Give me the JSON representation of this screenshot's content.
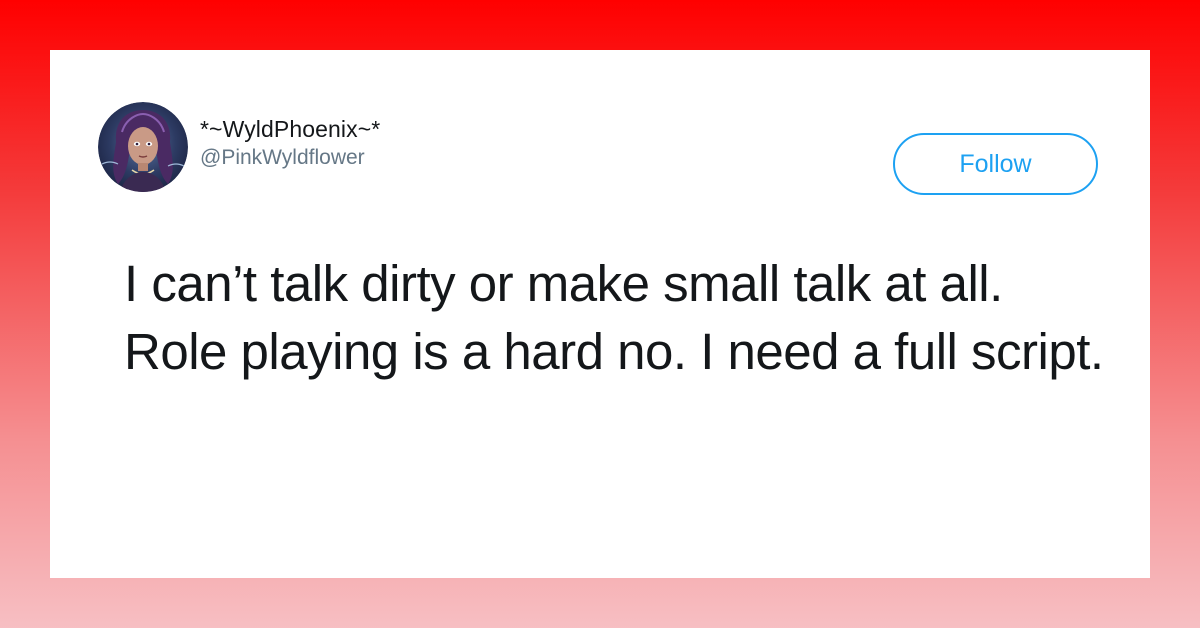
{
  "colors": {
    "frame_gradient_top": "#ff0000",
    "frame_gradient_bottom": "#f7bfc3",
    "card_background": "#ffffff",
    "text_primary": "#14171a",
    "text_secondary": "#657786",
    "accent": "#1da1f2"
  },
  "tweet": {
    "author": {
      "display_name": "*~WyldPhoenix~*",
      "handle": "@PinkWyldflower",
      "avatar_icon": "avatar-illustration"
    },
    "follow_label": "Follow",
    "text": "I can’t talk dirty or make small talk at all. Role playing is a hard no. I need a full script."
  }
}
